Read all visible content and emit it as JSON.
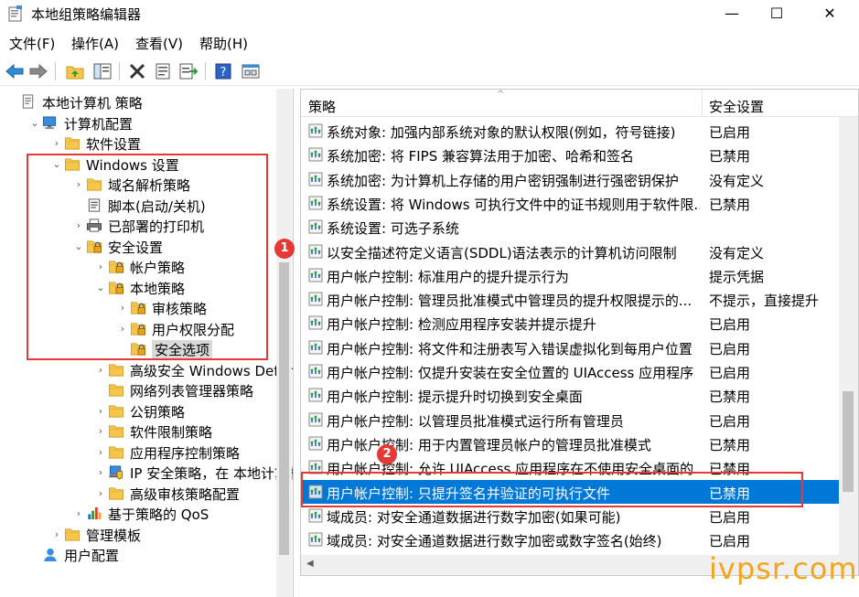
{
  "window": {
    "title": "本地组策略编辑器",
    "min": "—",
    "max": "☐",
    "close": "✕"
  },
  "menu": [
    "文件(F)",
    "操作(A)",
    "查看(V)",
    "帮助(H)"
  ],
  "tree": [
    {
      "label": "本地计算机 策略",
      "arrow": "",
      "icon": "computer-policy-icon",
      "level": 0
    },
    {
      "label": "计算机配置",
      "arrow": "⌄",
      "icon": "computer-config-icon",
      "level": 1
    },
    {
      "label": "软件设置",
      "arrow": "›",
      "icon": "folder-icon",
      "level": 2
    },
    {
      "label": "Windows 设置",
      "arrow": "⌄",
      "icon": "folder-icon",
      "level": 2
    },
    {
      "label": "域名解析策略",
      "arrow": "›",
      "icon": "folder-icon",
      "level": 3
    },
    {
      "label": "脚本(启动/关机)",
      "arrow": "",
      "icon": "script-icon",
      "level": 3
    },
    {
      "label": "已部署的打印机",
      "arrow": "›",
      "icon": "printer-icon",
      "level": 3
    },
    {
      "label": "安全设置",
      "arrow": "⌄",
      "icon": "security-folder-icon",
      "level": 3
    },
    {
      "label": "帐户策略",
      "arrow": "›",
      "icon": "security-folder-icon",
      "level": 4
    },
    {
      "label": "本地策略",
      "arrow": "⌄",
      "icon": "security-folder-icon",
      "level": 4
    },
    {
      "label": "审核策略",
      "arrow": "›",
      "icon": "security-folder-icon",
      "level": 5
    },
    {
      "label": "用户权限分配",
      "arrow": "›",
      "icon": "security-folder-icon",
      "level": 5
    },
    {
      "label": "安全选项",
      "arrow": "",
      "icon": "security-folder-icon",
      "level": 5
    },
    {
      "label": "高级安全 Windows Defender 防火墙",
      "arrow": "›",
      "icon": "folder-icon",
      "level": 4
    },
    {
      "label": "网络列表管理器策略",
      "arrow": "",
      "icon": "folder-icon",
      "level": 4
    },
    {
      "label": "公钥策略",
      "arrow": "›",
      "icon": "folder-icon",
      "level": 4
    },
    {
      "label": "软件限制策略",
      "arrow": "›",
      "icon": "folder-icon",
      "level": 4
    },
    {
      "label": "应用程序控制策略",
      "arrow": "›",
      "icon": "folder-icon",
      "level": 4
    },
    {
      "label": "IP 安全策略，在 本地计算机",
      "arrow": "›",
      "icon": "ip-security-icon",
      "level": 4
    },
    {
      "label": "高级审核策略配置",
      "arrow": "›",
      "icon": "folder-icon",
      "level": 4
    },
    {
      "label": "基于策略的 QoS",
      "arrow": "›",
      "icon": "qos-chart-icon",
      "level": 3
    },
    {
      "label": "管理模板",
      "arrow": "›",
      "icon": "folder-icon",
      "level": 2
    },
    {
      "label": "用户配置",
      "arrow": "",
      "icon": "user-config-icon",
      "level": 1
    }
  ],
  "list": {
    "header_policy": "策略",
    "header_setting": "安全设置",
    "rows": [
      {
        "policy": "系统对象: 加强内部系统对象的默认权限(例如，符号链接)",
        "setting": "已启用"
      },
      {
        "policy": "系统加密: 将 FIPS 兼容算法用于加密、哈希和签名",
        "setting": "已禁用"
      },
      {
        "policy": "系统加密: 为计算机上存储的用户密钥强制进行强密钥保护",
        "setting": "没有定义"
      },
      {
        "policy": "系统设置: 将 Windows 可执行文件中的证书规则用于软件限...",
        "setting": "已禁用"
      },
      {
        "policy": "系统设置: 可选子系统",
        "setting": ""
      },
      {
        "policy": "以安全描述符定义语言(SDDL)语法表示的计算机访问限制",
        "setting": "没有定义"
      },
      {
        "policy": "用户帐户控制: 标准用户的提升提示行为",
        "setting": "提示凭据"
      },
      {
        "policy": "用户帐户控制: 管理员批准模式中管理员的提升权限提示的...",
        "setting": "不提示，直接提升"
      },
      {
        "policy": "用户帐户控制: 检测应用程序安装并提示提升",
        "setting": "已启用"
      },
      {
        "policy": "用户帐户控制: 将文件和注册表写入错误虚拟化到每用户位置",
        "setting": "已启用"
      },
      {
        "policy": "用户帐户控制: 仅提升安装在安全位置的 UIAccess 应用程序",
        "setting": "已启用"
      },
      {
        "policy": "用户帐户控制: 提示提升时切换到安全桌面",
        "setting": "已禁用"
      },
      {
        "policy": "用户帐户控制: 以管理员批准模式运行所有管理员",
        "setting": "已启用"
      },
      {
        "policy": "用户帐户控制: 用于内置管理员帐户的管理员批准模式",
        "setting": "已禁用"
      },
      {
        "policy": "用户帐户控制: 允许 UIAccess 应用程序在不使用安全桌面的...",
        "setting": "已禁用"
      },
      {
        "policy": "用户帐户控制: 只提升签名并验证的可执行文件",
        "setting": "已禁用"
      },
      {
        "policy": "域成员: 对安全通道数据进行数字加密(如果可能)",
        "setting": "已启用"
      },
      {
        "policy": "域成员: 对安全通道数据进行数字加密或数字签名(始终)",
        "setting": "已启用"
      }
    ]
  },
  "annotations": {
    "badge1": "1",
    "badge2": "2"
  },
  "watermark": "ivpsr.com",
  "colors": {
    "selection": "#0078d7",
    "annotation": "#e53935",
    "watermark": "#f4a51c"
  }
}
